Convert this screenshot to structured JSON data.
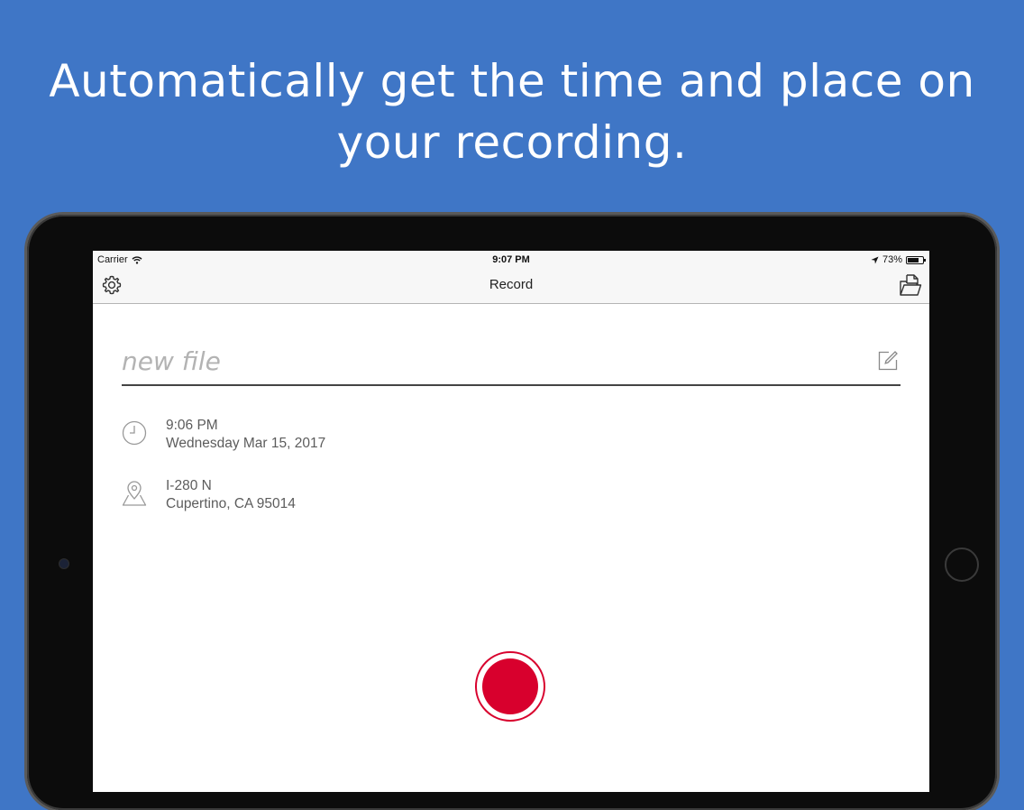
{
  "headline": {
    "line1": "Automatically get the time and place on",
    "line2": "your recording."
  },
  "statusbar": {
    "carrier": "Carrier",
    "time": "9:07 PM",
    "battery_text": "73%",
    "battery_level": 0.73
  },
  "navbar": {
    "title": "Record",
    "left_icon": "gear-icon",
    "right_icon": "folder-icon"
  },
  "file_name": {
    "value": "",
    "placeholder": "new file"
  },
  "time_info": {
    "time": "9:06 PM",
    "date": "Wednesday Mar 15, 2017"
  },
  "location_info": {
    "street": "I-280 N",
    "city": "Cupertino, CA 95014"
  },
  "colors": {
    "background": "#3f76c6",
    "record": "#d8002d"
  }
}
